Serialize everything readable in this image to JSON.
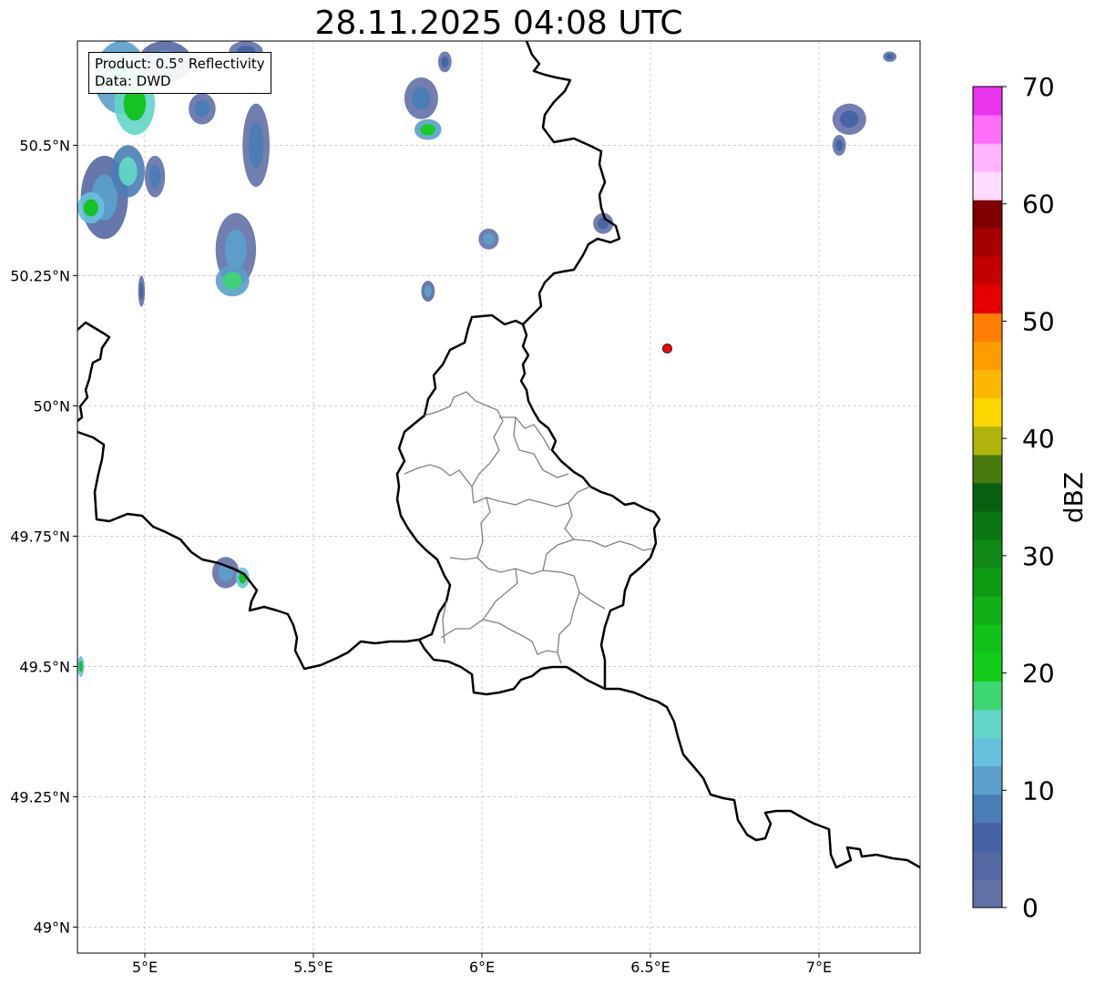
{
  "title": "28.11.2025 04:08 UTC",
  "info": {
    "product": "Product: 0.5° Reflectivity",
    "data": "Data: DWD"
  },
  "map": {
    "lon_range": [
      4.8,
      7.3
    ],
    "lat_range": [
      48.95,
      50.7
    ],
    "lon_ticks": [
      {
        "value": 5.0,
        "label": "5°E"
      },
      {
        "value": 5.5,
        "label": "5.5°E"
      },
      {
        "value": 6.0,
        "label": "6°E"
      },
      {
        "value": 6.5,
        "label": "6.5°E"
      },
      {
        "value": 7.0,
        "label": "7°E"
      }
    ],
    "lat_ticks": [
      {
        "value": 50.5,
        "label": "50.5°N"
      },
      {
        "value": 50.25,
        "label": "50.25°N"
      },
      {
        "value": 50.0,
        "label": "50°N"
      },
      {
        "value": 49.75,
        "label": "49.75°N"
      },
      {
        "value": 49.5,
        "label": "49.5°N"
      },
      {
        "value": 49.25,
        "label": "49.25°N"
      },
      {
        "value": 49.0,
        "label": "49°N"
      }
    ],
    "grid": true,
    "marker": {
      "lon": 6.55,
      "lat": 50.11,
      "color": "#ff0000"
    },
    "border_color": "#000000",
    "district_color": "#808080"
  },
  "colorbar": {
    "label": "dBZ",
    "min": 0,
    "max": 70,
    "tick_values": [
      0,
      10,
      20,
      30,
      40,
      50,
      60,
      70
    ],
    "tick_labels": [
      "0",
      "10",
      "20",
      "30",
      "40",
      "50",
      "60",
      "70"
    ],
    "colors": [
      "#6270a6",
      "#5468a2",
      "#4563a4",
      "#4a7db5",
      "#5b9fca",
      "#66c1dd",
      "#62d6c6",
      "#3ed672",
      "#13cc1a",
      "#12c21a",
      "#10af16",
      "#0f9a14",
      "#0f8816",
      "#0b7714",
      "#076010",
      "#487a0d",
      "#afb30a",
      "#fdd800",
      "#fcb800",
      "#ff9c00",
      "#ff7d00",
      "#e40000",
      "#c40000",
      "#a60000",
      "#7f0000",
      "#ffdcff",
      "#ffb4ff",
      "#ff6ef9",
      "#ea33ec"
    ]
  },
  "echoes": [
    {
      "lon": 4.93,
      "lat": 50.63,
      "rx": 0.08,
      "ry": 0.07,
      "dbz": 18
    },
    {
      "lon": 4.97,
      "lat": 50.58,
      "rx": 0.06,
      "ry": 0.06,
      "dbz": 24
    },
    {
      "lon": 5.06,
      "lat": 50.66,
      "rx": 0.08,
      "ry": 0.04,
      "dbz": 12
    },
    {
      "lon": 4.88,
      "lat": 50.4,
      "rx": 0.07,
      "ry": 0.08,
      "dbz": 12
    },
    {
      "lon": 4.84,
      "lat": 50.38,
      "rx": 0.04,
      "ry": 0.03,
      "dbz": 22
    },
    {
      "lon": 4.95,
      "lat": 50.45,
      "rx": 0.05,
      "ry": 0.05,
      "dbz": 16
    },
    {
      "lon": 5.03,
      "lat": 50.44,
      "rx": 0.03,
      "ry": 0.04,
      "dbz": 8
    },
    {
      "lon": 5.17,
      "lat": 50.57,
      "rx": 0.04,
      "ry": 0.03,
      "dbz": 8
    },
    {
      "lon": 5.33,
      "lat": 50.5,
      "rx": 0.04,
      "ry": 0.08,
      "dbz": 8
    },
    {
      "lon": 5.3,
      "lat": 50.68,
      "rx": 0.05,
      "ry": 0.02,
      "dbz": 6
    },
    {
      "lon": 5.27,
      "lat": 50.3,
      "rx": 0.06,
      "ry": 0.07,
      "dbz": 10
    },
    {
      "lon": 5.26,
      "lat": 50.24,
      "rx": 0.05,
      "ry": 0.03,
      "dbz": 18
    },
    {
      "lon": 4.99,
      "lat": 50.22,
      "rx": 0.01,
      "ry": 0.03,
      "dbz": 6
    },
    {
      "lon": 5.82,
      "lat": 50.59,
      "rx": 0.05,
      "ry": 0.04,
      "dbz": 8
    },
    {
      "lon": 5.84,
      "lat": 50.53,
      "rx": 0.04,
      "ry": 0.02,
      "dbz": 20
    },
    {
      "lon": 5.89,
      "lat": 50.66,
      "rx": 0.02,
      "ry": 0.02,
      "dbz": 6
    },
    {
      "lon": 6.02,
      "lat": 50.32,
      "rx": 0.03,
      "ry": 0.02,
      "dbz": 10
    },
    {
      "lon": 5.84,
      "lat": 50.22,
      "rx": 0.02,
      "ry": 0.02,
      "dbz": 12
    },
    {
      "lon": 5.24,
      "lat": 49.68,
      "rx": 0.04,
      "ry": 0.03,
      "dbz": 10
    },
    {
      "lon": 5.29,
      "lat": 49.67,
      "rx": 0.02,
      "ry": 0.02,
      "dbz": 22
    },
    {
      "lon": 6.36,
      "lat": 50.35,
      "rx": 0.03,
      "ry": 0.02,
      "dbz": 6
    },
    {
      "lon": 7.09,
      "lat": 50.55,
      "rx": 0.05,
      "ry": 0.03,
      "dbz": 6
    },
    {
      "lon": 7.06,
      "lat": 50.5,
      "rx": 0.02,
      "ry": 0.02,
      "dbz": 6
    },
    {
      "lon": 7.21,
      "lat": 50.67,
      "rx": 0.02,
      "ry": 0.01,
      "dbz": 6
    },
    {
      "lon": 4.81,
      "lat": 49.5,
      "rx": 0.01,
      "ry": 0.02,
      "dbz": 22
    }
  ]
}
